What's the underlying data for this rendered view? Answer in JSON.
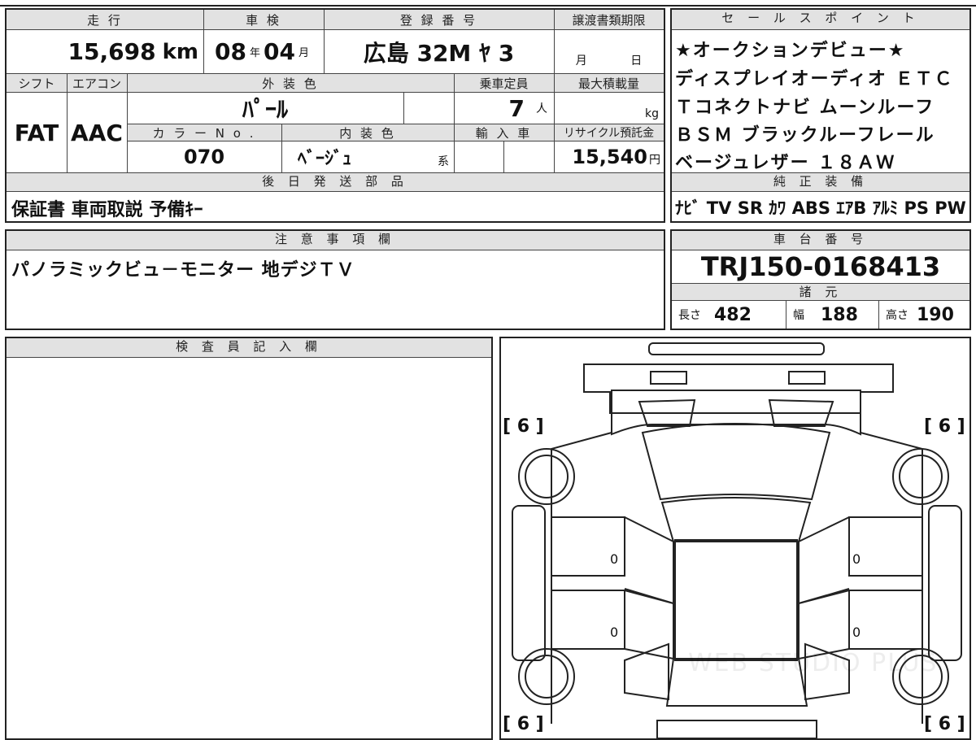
{
  "top_table": {
    "headers": {
      "mileage": "走 行",
      "inspection": "車 検",
      "registration": "登 録 番 号",
      "transfer_deadline": "譲渡書類期限",
      "shift": "シフト",
      "aircon": "エアコン",
      "exterior_color": "外 装 色",
      "capacity": "乗車定員",
      "max_load": "最大積載量",
      "color_no": "カ ラ ー N o .",
      "interior_color": "内 装 色",
      "import": "輸 入 車",
      "recycle_fee": "リサイクル預託金"
    },
    "mileage_value": "15,698",
    "mileage_unit": "km",
    "inspection_year": "08",
    "inspection_year_unit": "年",
    "inspection_month": "04",
    "inspection_month_unit": "月",
    "registration_value": "広島 32M ﾔ 3",
    "transfer_month_unit": "月",
    "transfer_day_unit": "日",
    "shift_value": "FAT",
    "aircon_value": "AAC",
    "exterior_color_value": "ﾊﾟｰﾙ",
    "capacity_value": "7",
    "capacity_unit": "人",
    "max_load_unit": "kg",
    "color_no_value": "070",
    "interior_color_value": "ﾍﾞｰｼﾞｭ",
    "interior_color_suffix": "系",
    "recycle_fee_value": "15,540",
    "recycle_fee_unit": "円"
  },
  "later_parts": {
    "header": "後 日 発 送 部 品",
    "value": "保証書 車両取説 予備ｷｰ"
  },
  "sales_points": {
    "header": "セ ー ル ス ポ イ ン ト",
    "lines": [
      "★オークションデビュー★",
      "ディスプレイオーディオ ＥＴＣ",
      "Ｔコネクトナビ ムーンルーフ",
      "ＢＳＭ ブラックルーフレール",
      "ベージュレザー １８ＡＷ"
    ]
  },
  "equipment": {
    "header": "純 正 装 備",
    "value": "ﾅﾋﾞ TV SR ｶﾜ ABS ｴｱB ｱﾙﾐ PS PW"
  },
  "notes": {
    "header": "注 意 事 項 欄",
    "value": "パノラミックビュ－モニター 地デジＴＶ"
  },
  "chassis": {
    "header": "車 台 番 号",
    "value": "TRJ150-0168413"
  },
  "specs": {
    "header": "諸 元",
    "length_label": "長さ",
    "length_value": "482",
    "width_label": "幅",
    "width_value": "188",
    "height_label": "高さ",
    "height_value": "190"
  },
  "inspector": {
    "header": "検 査 員 記 入 欄"
  },
  "diagram": {
    "tire_front_left": "[ 6 ]",
    "tire_front_right": "[ 6 ]",
    "tire_rear_left": "[ 6 ]",
    "tire_rear_right": "[ 6 ]",
    "mark_left_front_door": "0",
    "mark_left_rear_door": "0",
    "mark_right_front_door": "0",
    "mark_right_rear_door": "0",
    "watermark": "WEB STUDIO PLUS"
  }
}
